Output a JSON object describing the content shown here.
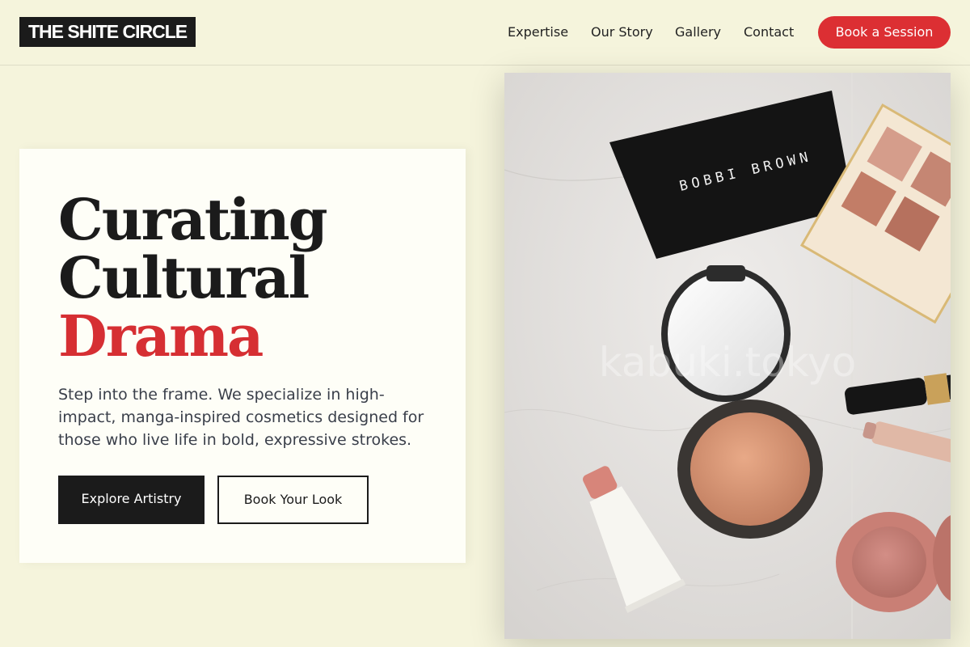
{
  "header": {
    "logo": "THE SHITE CIRCLE",
    "nav": [
      "Expertise",
      "Our Story",
      "Gallery",
      "Contact"
    ],
    "cta": "Book a Session"
  },
  "hero": {
    "headline_line1": "Curating",
    "headline_line2": "Cultural",
    "headline_accent": "Drama",
    "description": "Step into the frame. We specialize in high-impact, manga-inspired cosmetics designed for those who live life in bold, expressive strokes.",
    "primary_button": "Explore Artistry",
    "secondary_button": "Book Your Look"
  },
  "image": {
    "brand_text": "BOBBI BROWN",
    "watermark": "kabuki.tokyo"
  },
  "colors": {
    "background": "#f5f4dc",
    "accent": "#d62f33",
    "dark": "#1b1b1b"
  }
}
